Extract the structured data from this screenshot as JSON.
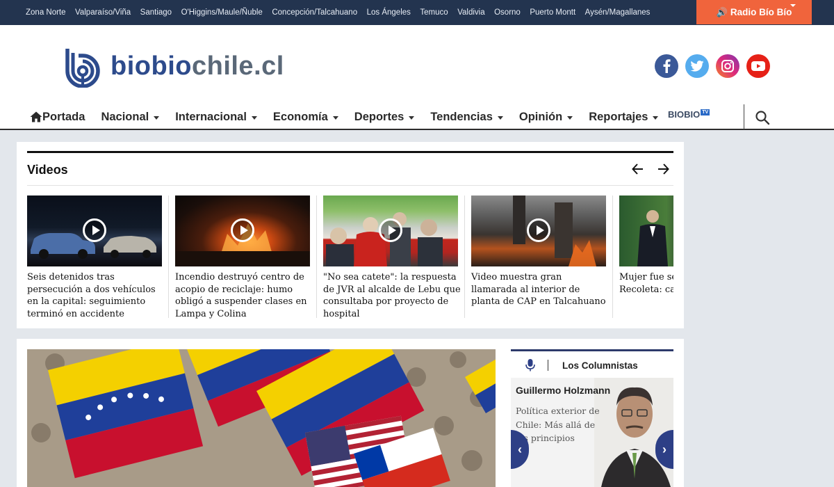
{
  "topbar": {
    "regions": [
      "Zona Norte",
      "Valparaíso/Viña",
      "Santiago",
      "O'Higgins/Maule/Ñuble",
      "Concepción/Talcahuano",
      "Los Ángeles",
      "Temuco",
      "Valdivia",
      "Osorno",
      "Puerto Montt",
      "Aysén/Magallanes"
    ],
    "radio_label": "Radio Bío Bío",
    "colors": {
      "bar": "#23344f",
      "radio": "#f0643c"
    }
  },
  "header": {
    "logo": {
      "part1": "biobio",
      "part2": "chile.cl"
    },
    "social": [
      "facebook-icon",
      "twitter-icon",
      "instagram-icon",
      "youtube-icon"
    ]
  },
  "nav": {
    "items": [
      {
        "label": "Portada",
        "icon": "home-icon",
        "dropdown": false
      },
      {
        "label": "Nacional",
        "dropdown": true
      },
      {
        "label": "Internacional",
        "dropdown": true
      },
      {
        "label": "Economía",
        "dropdown": true
      },
      {
        "label": "Deportes",
        "dropdown": true
      },
      {
        "label": "Tendencias",
        "dropdown": true
      },
      {
        "label": "Opinión",
        "dropdown": true
      },
      {
        "label": "Reportajes",
        "dropdown": true
      }
    ],
    "tv_label": "BIOBIO",
    "tv_badge": "TV"
  },
  "videos": {
    "title": "Videos",
    "items": [
      {
        "caption": "Seis detenidos tras persecución a dos vehículos en la capital: seguimiento terminó en accidente"
      },
      {
        "caption": "Incendio destruyó centro de acopio de reciclaje: humo obligó a suspender clases en Lampa y Colina"
      },
      {
        "caption": "\"No sea catete\": la respuesta de JVR al alcalde de Lebu que consultaba por proyecto de hospital"
      },
      {
        "caption": "Video muestra gran llamarada al interior de planta de CAP en Talcahuano"
      },
      {
        "caption": "Mujer fue se violada por Recoleta: ca presunto au"
      }
    ]
  },
  "columnists": {
    "title": "Los Columnistas",
    "name": "Guillermo Holzmann",
    "article": "Política exterior de Chile: Más allá de los principios"
  }
}
